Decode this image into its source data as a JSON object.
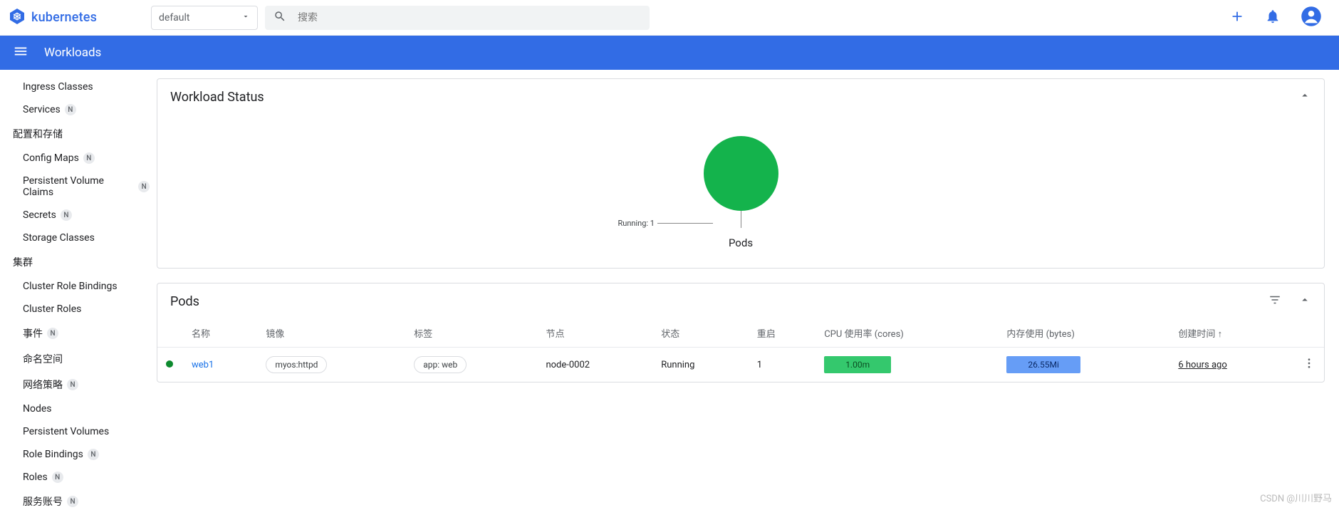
{
  "header": {
    "logo_text": "kubernetes",
    "namespace": "default",
    "search_placeholder": "搜索",
    "title": "Workloads"
  },
  "sidebar": {
    "items": [
      {
        "label": "Ingress Classes",
        "header": false,
        "badge": null
      },
      {
        "label": "Services",
        "header": false,
        "badge": "N"
      },
      {
        "label": "配置和存储",
        "header": true,
        "badge": null
      },
      {
        "label": "Config Maps",
        "header": false,
        "badge": "N"
      },
      {
        "label": "Persistent Volume Claims",
        "header": false,
        "badge": "N"
      },
      {
        "label": "Secrets",
        "header": false,
        "badge": "N"
      },
      {
        "label": "Storage Classes",
        "header": false,
        "badge": null
      },
      {
        "label": "集群",
        "header": true,
        "badge": null
      },
      {
        "label": "Cluster Role Bindings",
        "header": false,
        "badge": null
      },
      {
        "label": "Cluster Roles",
        "header": false,
        "badge": null
      },
      {
        "label": "事件",
        "header": false,
        "badge": "N"
      },
      {
        "label": "命名空间",
        "header": false,
        "badge": null
      },
      {
        "label": "网络策略",
        "header": false,
        "badge": "N"
      },
      {
        "label": "Nodes",
        "header": false,
        "badge": null
      },
      {
        "label": "Persistent Volumes",
        "header": false,
        "badge": null
      },
      {
        "label": "Role Bindings",
        "header": false,
        "badge": "N"
      },
      {
        "label": "Roles",
        "header": false,
        "badge": "N"
      },
      {
        "label": "服务账号",
        "header": false,
        "badge": "N"
      }
    ]
  },
  "workload_status": {
    "card_title": "Workload Status",
    "label": "Running: 1",
    "caption": "Pods"
  },
  "chart_data": {
    "type": "pie",
    "title": "Pods",
    "series": [
      {
        "name": "Running",
        "value": 1
      }
    ],
    "total": 1,
    "colors": {
      "Running": "#14b34c"
    }
  },
  "pods_card": {
    "title": "Pods",
    "columns": [
      "名称",
      "镜像",
      "标签",
      "节点",
      "状态",
      "重启",
      "CPU 使用率 (cores)",
      "内存使用 (bytes)",
      "创建时间 ↑"
    ],
    "rows": [
      {
        "name": "web1",
        "image": "myos:httpd",
        "label": "app: web",
        "node": "node-0002",
        "status": "Running",
        "restarts": "1",
        "cpu": "1.00m",
        "mem": "26.55Mi",
        "created": "6 hours ago"
      }
    ]
  },
  "watermark": "CSDN @川川野马"
}
